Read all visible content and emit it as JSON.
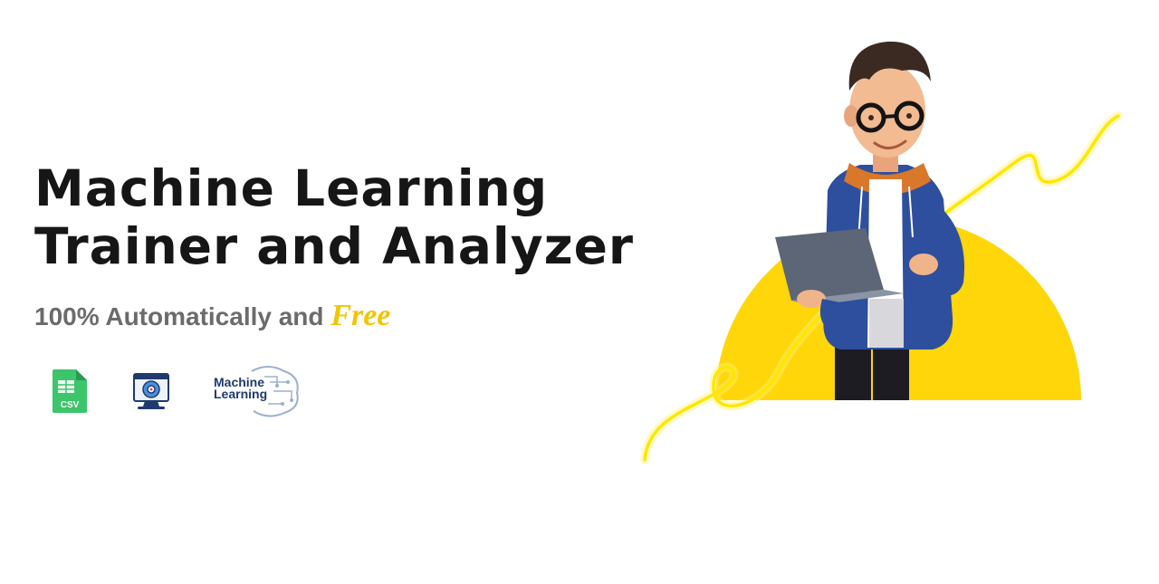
{
  "hero": {
    "title_line1": "Machine Learning",
    "title_line2": "Trainer and Analyzer",
    "subtitle_prefix": "100% Automatically and ",
    "subtitle_highlight": "Free"
  },
  "icons": {
    "csv_label": "CSV",
    "ml_logo_line1": "Machine",
    "ml_logo_line2": "Learning"
  },
  "colors": {
    "accent_yellow": "#f3c400",
    "title": "#161616",
    "subtitle": "#6b6b6b",
    "csv_green": "#3cc56b",
    "ml_navy": "#1f3a6e"
  }
}
